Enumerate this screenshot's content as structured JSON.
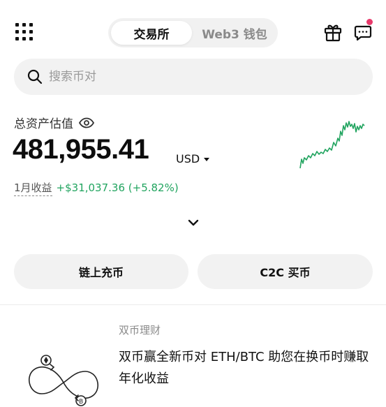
{
  "header": {
    "tabs": [
      {
        "label": "交易所",
        "active": true
      },
      {
        "label": "Web3 钱包",
        "active": false
      }
    ],
    "icons": [
      "grid-menu-icon",
      "gift-icon",
      "chat-icon"
    ],
    "notification_dot_color": "#e8396b"
  },
  "search": {
    "placeholder": "搜索币对"
  },
  "assets": {
    "label": "总资产估值",
    "balance": "481,955.41",
    "currency": "USD",
    "period_label": "1月收益",
    "period_gain": "+$31,037.36 (+5.82%)",
    "gain_color": "#21a45f"
  },
  "actions": {
    "onchain_deposit": "链上充币",
    "c2c_buy": "C2C 买币"
  },
  "product": {
    "tag": "双币理财",
    "title": "双币赢全新币对 ETH/BTC 助您在换币时赚取年化收益",
    "icon": "dual-currency-infinity-icon"
  },
  "colors": {
    "accent_green": "#21a45f",
    "surface_gray": "#f2f2f2"
  }
}
